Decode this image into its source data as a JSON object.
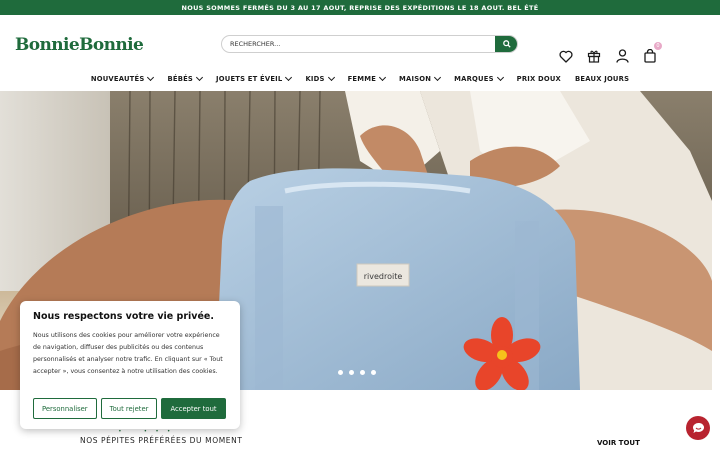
{
  "announcement": "NOUS SOMMES FERMÉS DU 3 AU 17 AOUT, REPRISE DES EXPÉDITIONS LE 18 AOUT. BEL ÉTÉ",
  "logo": "BonnieBonnie",
  "search": {
    "placeholder": "RECHERCHER..."
  },
  "header_icons": [
    "heart-icon",
    "gift-icon",
    "user-icon",
    "bag-icon"
  ],
  "cart_count": "0",
  "nav": [
    {
      "label": "NOUVEAUTÉS",
      "dropdown": true
    },
    {
      "label": "BÉBÉS",
      "dropdown": true
    },
    {
      "label": "JOUETS ET ÉVEIL",
      "dropdown": true
    },
    {
      "label": "KIDS",
      "dropdown": true
    },
    {
      "label": "FEMME",
      "dropdown": true
    },
    {
      "label": "MAISON",
      "dropdown": true
    },
    {
      "label": "MARQUES",
      "dropdown": true
    },
    {
      "label": "PRIX DOUX",
      "dropdown": false
    },
    {
      "label": "BEAUX JOURS",
      "dropdown": false
    }
  ],
  "hero": {
    "bag_label": "rivedroite",
    "slide_count": 4
  },
  "cookie": {
    "title": "Nous respectons votre vie privée.",
    "body": "Nous utilisons des cookies pour améliorer votre expérience de navigation, diffuser des publicités ou des contenus personnalisés et analyser notre trafic. En cliquant sur « Tout accepter », vous consentez à notre utilisation des cookies.",
    "customize": "Personnaliser",
    "reject": "Tout rejeter",
    "accept": "Accepter tout"
  },
  "section": {
    "subtitle": "NOS PÉPITES PRÉFÉRÉES DU MOMENT",
    "see_all": "VOIR TOUT"
  },
  "colors": {
    "brand": "#1f6b3c",
    "badge": "#e8a9c7",
    "chat": "#b8232f",
    "flower": "#e8452a"
  }
}
